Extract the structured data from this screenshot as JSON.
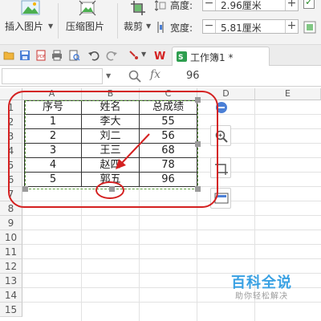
{
  "ribbon": {
    "insert_picture_label": "插入图片",
    "compress_picture_label": "压缩图片",
    "crop_label": "裁剪",
    "height_label": "高度:",
    "height_value": "2.96厘米",
    "width_label": "宽度:",
    "width_value": "5.81厘米",
    "lock_icon": "checkbox-icon"
  },
  "tab": {
    "title": "工作簿1 *"
  },
  "formula_bar": {
    "fx_label": "fx",
    "value": "96"
  },
  "columns": [
    "A",
    "B",
    "C",
    "D",
    "E"
  ],
  "rows": [
    "1",
    "2",
    "3",
    "4",
    "5",
    "6",
    "7",
    "8",
    "9",
    "10",
    "11",
    "12",
    "13",
    "14",
    "15"
  ],
  "table": {
    "headers": [
      "序号",
      "姓名",
      "总成绩"
    ],
    "rows": [
      [
        "1",
        "李大",
        "55"
      ],
      [
        "2",
        "刘二",
        "56"
      ],
      [
        "3",
        "王三",
        "68"
      ],
      [
        "4",
        "赵四",
        "78"
      ],
      [
        "5",
        "郭五",
        "96"
      ]
    ]
  },
  "colors": {
    "annotation_red": "#d42020",
    "selection_green": "#5a9a3a",
    "accent_blue": "#4a7fd6",
    "watermark_blue": "#39a1e3"
  },
  "watermark": {
    "main": "百科全说",
    "sub": "助你轻松解决"
  }
}
